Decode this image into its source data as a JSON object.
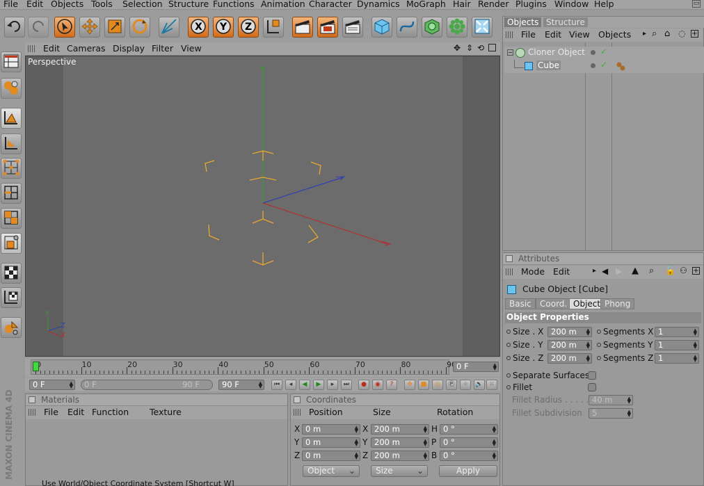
{
  "menubar": {
    "items": [
      "File",
      "Edit",
      "Objects",
      "Tools",
      "Selection",
      "Structure",
      "Functions",
      "Animation",
      "Character",
      "Dynamics",
      "MoGraph",
      "Hair",
      "Render",
      "Plugins",
      "Window",
      "Help"
    ]
  },
  "viewport": {
    "menu": [
      "Edit",
      "Cameras",
      "Display",
      "Filter",
      "View"
    ],
    "label": "Perspective",
    "axis_x": "X",
    "axis_y": "Y",
    "axis_z": "Z"
  },
  "timeline": {
    "ticks": [
      "0",
      "10",
      "20",
      "30",
      "40",
      "50",
      "60",
      "70",
      "80",
      "90"
    ],
    "current_frame": "0 F",
    "start_frame": "0 F",
    "range_start": "0 F",
    "range_end": "90 F",
    "end_frame": "90 F",
    "playhead_fraction": 0.0
  },
  "objects_panel": {
    "tabs": [
      "Objects",
      "Structure"
    ],
    "menu": [
      "File",
      "Edit",
      "View",
      "Objects"
    ],
    "items": [
      {
        "name": "Cloner Object",
        "depth": 0
      },
      {
        "name": "Cube",
        "depth": 1
      }
    ]
  },
  "attributes": {
    "title": "Attributes",
    "menu": [
      "Mode",
      "Edit"
    ],
    "object_title": "Cube Object [Cube]",
    "tabs": [
      "Basic",
      "Coord.",
      "Object",
      "Phong"
    ],
    "active_tab": "Object",
    "section": "Object Properties",
    "size_x_label": "Size . X",
    "size_x": "200 m",
    "size_y_label": "Size . Y",
    "size_y": "200 m",
    "size_z_label": "Size . Z",
    "size_z": "200 m",
    "seg_x_label": "Segments X",
    "seg_x": "1",
    "seg_y_label": "Segments Y",
    "seg_y": "1",
    "seg_z_label": "Segments Z",
    "seg_z": "1",
    "separate_label": "Separate Surfaces",
    "fillet_label": "Fillet",
    "fillet_radius_label": "Fillet Radius . . . . . . . .",
    "fillet_radius": "40 m",
    "fillet_subdiv_label": "Fillet Subdivision",
    "fillet_subdiv": "5"
  },
  "materials": {
    "title": "Materials",
    "menu": [
      "File",
      "Edit",
      "Function",
      "Texture"
    ]
  },
  "coordinates": {
    "title": "Coordinates",
    "headers": [
      "Position",
      "Size",
      "Rotation"
    ],
    "rows": [
      {
        "axis": "X",
        "pos": "0 m",
        "size_axis": "X",
        "size": "200 m",
        "rot_axis": "H",
        "rot": "0 °"
      },
      {
        "axis": "Y",
        "pos": "0 m",
        "size_axis": "Y",
        "size": "200 m",
        "rot_axis": "P",
        "rot": "0 °"
      },
      {
        "axis": "Z",
        "pos": "0 m",
        "size_axis": "Z",
        "size": "200 m",
        "rot_axis": "B",
        "rot": "0 °"
      }
    ],
    "mode_select": "Object",
    "size_select": "Size",
    "apply_label": "Apply"
  },
  "status": {
    "text": "Use World/Object Coordinate System [Shortcut W]"
  },
  "logo": {
    "text": "MAXON CINEMA 4D"
  },
  "colors": {
    "accent_orange": "#e07a20",
    "axis_x": "#b03030",
    "axis_y": "#3a9a3a",
    "axis_z": "#3040b0",
    "selection_yellow": "#e8a830"
  }
}
